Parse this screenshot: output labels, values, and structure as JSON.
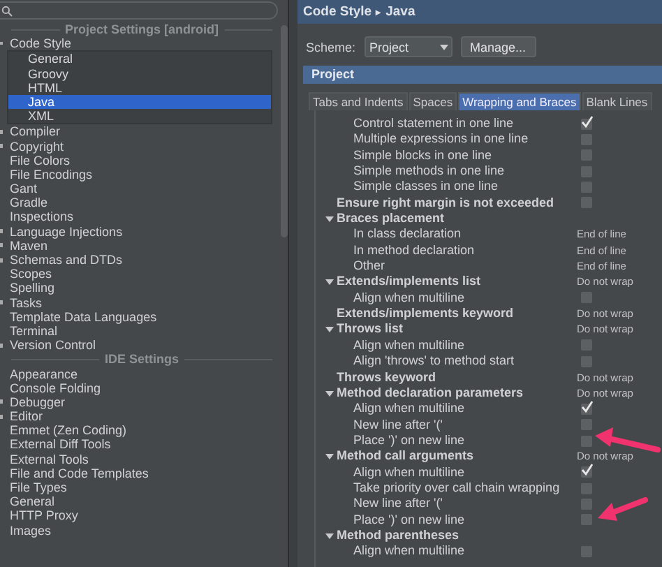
{
  "sidebar": {
    "sections": [
      {
        "header": "Project Settings [android]",
        "items": [
          {
            "label": "Code Style",
            "expanded": true,
            "selected": false,
            "children": [
              {
                "label": "General",
                "selected": false
              },
              {
                "label": "Groovy",
                "selected": false
              },
              {
                "label": "HTML",
                "selected": false
              },
              {
                "label": "Java",
                "selected": true
              },
              {
                "label": "XML",
                "selected": false
              }
            ]
          },
          {
            "label": "Compiler",
            "expanded": false,
            "selected": false
          },
          {
            "label": "Copyright",
            "expanded": false,
            "selected": false
          },
          {
            "label": "File Colors",
            "selected": false
          },
          {
            "label": "File Encodings",
            "selected": false
          },
          {
            "label": "Gant",
            "selected": false
          },
          {
            "label": "Gradle",
            "selected": false
          },
          {
            "label": "Inspections",
            "selected": false
          },
          {
            "label": "Language Injections",
            "expanded": false,
            "selected": false
          },
          {
            "label": "Maven",
            "expanded": false,
            "selected": false
          },
          {
            "label": "Schemas and DTDs",
            "expanded": false,
            "selected": false
          },
          {
            "label": "Scopes",
            "selected": false
          },
          {
            "label": "Spelling",
            "selected": false
          },
          {
            "label": "Tasks",
            "expanded": false,
            "selected": false
          },
          {
            "label": "Template Data Languages",
            "selected": false
          },
          {
            "label": "Terminal",
            "selected": false
          },
          {
            "label": "Version Control",
            "expanded": false,
            "selected": false
          }
        ]
      },
      {
        "header": "IDE Settings",
        "items": [
          {
            "label": "Appearance",
            "selected": false
          },
          {
            "label": "Console Folding",
            "selected": false
          },
          {
            "label": "Debugger",
            "expanded": false,
            "selected": false
          },
          {
            "label": "Editor",
            "expanded": false,
            "selected": false
          },
          {
            "label": "Emmet (Zen Coding)",
            "selected": false
          },
          {
            "label": "External Diff Tools",
            "selected": false
          },
          {
            "label": "External Tools",
            "selected": false
          },
          {
            "label": "File and Code Templates",
            "selected": false
          },
          {
            "label": "File Types",
            "selected": false
          },
          {
            "label": "General",
            "selected": false
          },
          {
            "label": "HTTP Proxy",
            "selected": false
          },
          {
            "label": "Images",
            "selected": false
          }
        ]
      }
    ]
  },
  "breadcrumb": {
    "parent": "Code Style",
    "separator": "▸",
    "current": "Java"
  },
  "scheme": {
    "label": "Scheme:",
    "value": "Project",
    "button": "Manage..."
  },
  "section_title": "Project",
  "tabs": [
    {
      "label": "Tabs and Indents",
      "selected": false
    },
    {
      "label": "Spaces",
      "selected": false
    },
    {
      "label": "Wrapping and Braces",
      "selected": true
    },
    {
      "label": "Blank Lines",
      "selected": false
    }
  ],
  "options": {
    "continued": [
      {
        "label": "Control statement in one line",
        "kind": "checkbox",
        "checked": true
      },
      {
        "label": "Multiple expressions in one line",
        "kind": "checkbox",
        "checked": false
      },
      {
        "label": "Simple blocks in one line",
        "kind": "checkbox",
        "checked": false
      },
      {
        "label": "Simple methods in one line",
        "kind": "checkbox",
        "checked": false
      },
      {
        "label": "Simple classes in one line",
        "kind": "checkbox",
        "checked": false
      }
    ],
    "items": [
      {
        "label": "Ensure right margin is not exceeded",
        "kind": "checkbox",
        "checked": false
      },
      {
        "label": "Braces placement",
        "kind": "group",
        "expanded": true,
        "children": [
          {
            "label": "In class declaration",
            "kind": "value",
            "value": "End of line"
          },
          {
            "label": "In method declaration",
            "kind": "value",
            "value": "End of line"
          },
          {
            "label": "Other",
            "kind": "value",
            "value": "End of line"
          }
        ]
      },
      {
        "label": "Extends/implements list",
        "kind": "value",
        "value": "Do not wrap",
        "expanded": true,
        "children": [
          {
            "label": "Align when multiline",
            "kind": "checkbox",
            "checked": false
          }
        ]
      },
      {
        "label": "Extends/implements keyword",
        "kind": "value",
        "value": "Do not wrap"
      },
      {
        "label": "Throws list",
        "kind": "value",
        "value": "Do not wrap",
        "expanded": true,
        "children": [
          {
            "label": "Align when multiline",
            "kind": "checkbox",
            "checked": false
          },
          {
            "label": "Align 'throws' to method start",
            "kind": "checkbox",
            "checked": false
          }
        ]
      },
      {
        "label": "Throws keyword",
        "kind": "value",
        "value": "Do not wrap"
      },
      {
        "label": "Method declaration parameters",
        "kind": "value",
        "value": "Do not wrap",
        "expanded": true,
        "children": [
          {
            "label": "Align when multiline",
            "kind": "checkbox",
            "checked": true
          },
          {
            "label": "New line after '('",
            "kind": "checkbox",
            "checked": false
          },
          {
            "label": "Place ')' on new line",
            "kind": "checkbox",
            "checked": false
          }
        ]
      },
      {
        "label": "Method call arguments",
        "kind": "value",
        "value": "Do not wrap",
        "expanded": true,
        "children": [
          {
            "label": "Align when multiline",
            "kind": "checkbox",
            "checked": true
          },
          {
            "label": "Take priority over call chain wrapping",
            "kind": "checkbox",
            "checked": false
          },
          {
            "label": "New line after '('",
            "kind": "checkbox",
            "checked": false
          },
          {
            "label": "Place ')' on new line",
            "kind": "checkbox",
            "checked": false
          }
        ]
      },
      {
        "label": "Method parentheses",
        "kind": "group",
        "expanded": true,
        "children": [
          {
            "label": "Align when multiline",
            "kind": "checkbox",
            "checked": false
          }
        ]
      }
    ]
  }
}
